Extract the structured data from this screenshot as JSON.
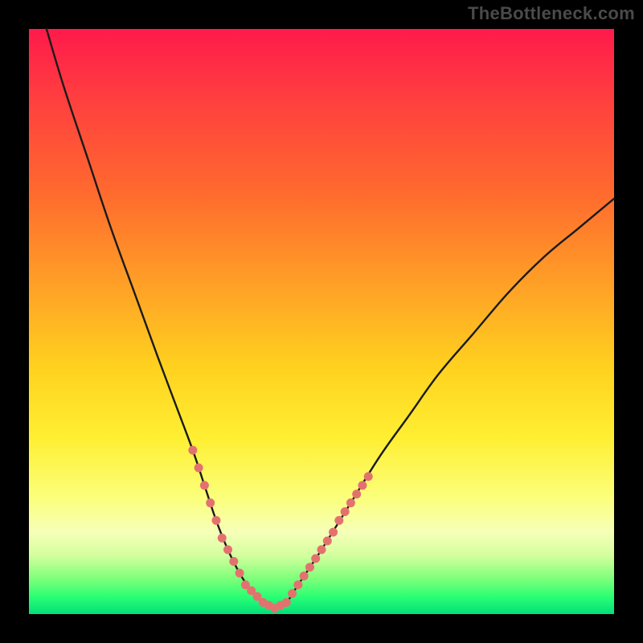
{
  "watermark": "TheBottleneck.com",
  "colors": {
    "frame_bg": "#000000",
    "curve_stroke": "#1a1a1a",
    "marker_fill": "#e3726f",
    "gradient_stops": [
      "#ff1a4b",
      "#ff3f3f",
      "#ff6a2e",
      "#ffa126",
      "#ffd21f",
      "#ffef33",
      "#fbff7a",
      "#f6ffb8",
      "#d3ff9e",
      "#7dff7a",
      "#2cff73",
      "#00e07a"
    ]
  },
  "chart_data": {
    "type": "line",
    "title": "",
    "xlabel": "",
    "ylabel": "",
    "xlim": [
      0,
      100
    ],
    "ylim": [
      0,
      100
    ],
    "grid": false,
    "legend": false,
    "series": [
      {
        "name": "bottleneck-curve",
        "x": [
          3,
          6,
          10,
          14,
          18,
          22,
          25,
          28,
          30,
          32,
          34,
          36,
          38,
          40,
          42,
          44,
          46,
          50,
          55,
          60,
          65,
          70,
          76,
          82,
          88,
          94,
          100
        ],
        "y": [
          100,
          90,
          78,
          66,
          55,
          44,
          36,
          28,
          22,
          16,
          11,
          7,
          4,
          2,
          1,
          2,
          5,
          11,
          19,
          27,
          34,
          41,
          48,
          55,
          61,
          66,
          71
        ]
      }
    ],
    "markers": [
      {
        "x": 28,
        "y": 28
      },
      {
        "x": 29,
        "y": 25
      },
      {
        "x": 30,
        "y": 22
      },
      {
        "x": 31,
        "y": 19
      },
      {
        "x": 32,
        "y": 16
      },
      {
        "x": 33,
        "y": 13
      },
      {
        "x": 34,
        "y": 11
      },
      {
        "x": 35,
        "y": 9
      },
      {
        "x": 36,
        "y": 7
      },
      {
        "x": 37,
        "y": 5
      },
      {
        "x": 38,
        "y": 4
      },
      {
        "x": 39,
        "y": 3
      },
      {
        "x": 40,
        "y": 2
      },
      {
        "x": 41,
        "y": 1.5
      },
      {
        "x": 42,
        "y": 1
      },
      {
        "x": 43,
        "y": 1.5
      },
      {
        "x": 44,
        "y": 2
      },
      {
        "x": 45,
        "y": 3.5
      },
      {
        "x": 46,
        "y": 5
      },
      {
        "x": 47,
        "y": 6.5
      },
      {
        "x": 48,
        "y": 8
      },
      {
        "x": 49,
        "y": 9.5
      },
      {
        "x": 50,
        "y": 11
      },
      {
        "x": 51,
        "y": 12.5
      },
      {
        "x": 52,
        "y": 14
      },
      {
        "x": 53,
        "y": 16
      },
      {
        "x": 54,
        "y": 17.5
      },
      {
        "x": 55,
        "y": 19
      },
      {
        "x": 56,
        "y": 20.5
      },
      {
        "x": 57,
        "y": 22
      },
      {
        "x": 58,
        "y": 23.5
      }
    ]
  }
}
